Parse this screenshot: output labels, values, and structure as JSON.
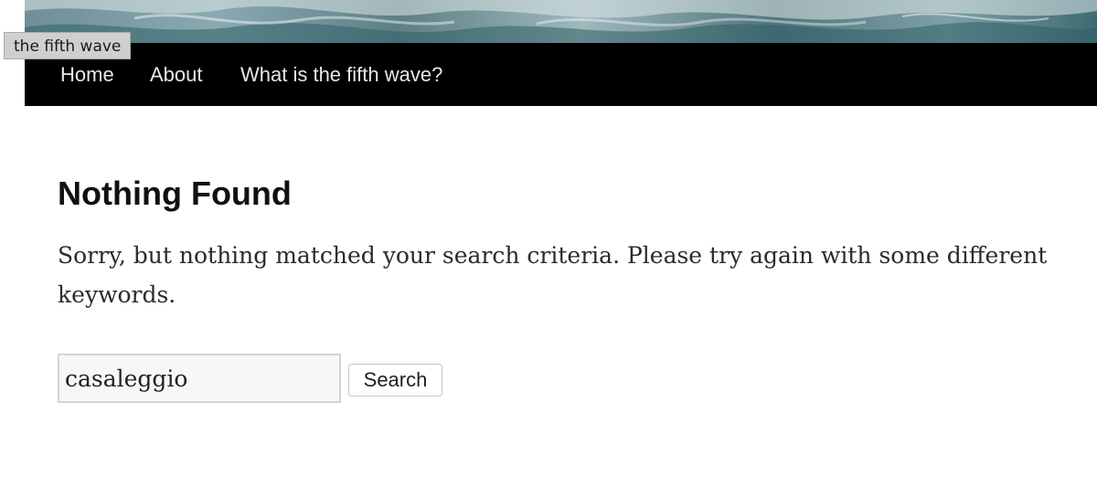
{
  "tooltip": {
    "text": "the fifth wave"
  },
  "nav": {
    "items": [
      {
        "label": "Home"
      },
      {
        "label": "About"
      },
      {
        "label": "What is the fifth wave?"
      }
    ],
    "background": "#000000",
    "text_color": "#e8e8e8"
  },
  "main": {
    "title": "Nothing Found",
    "message": "Sorry, but nothing matched your search criteria. Please try again with some different keywords."
  },
  "search": {
    "value": "casaleggio",
    "button_label": "Search"
  }
}
